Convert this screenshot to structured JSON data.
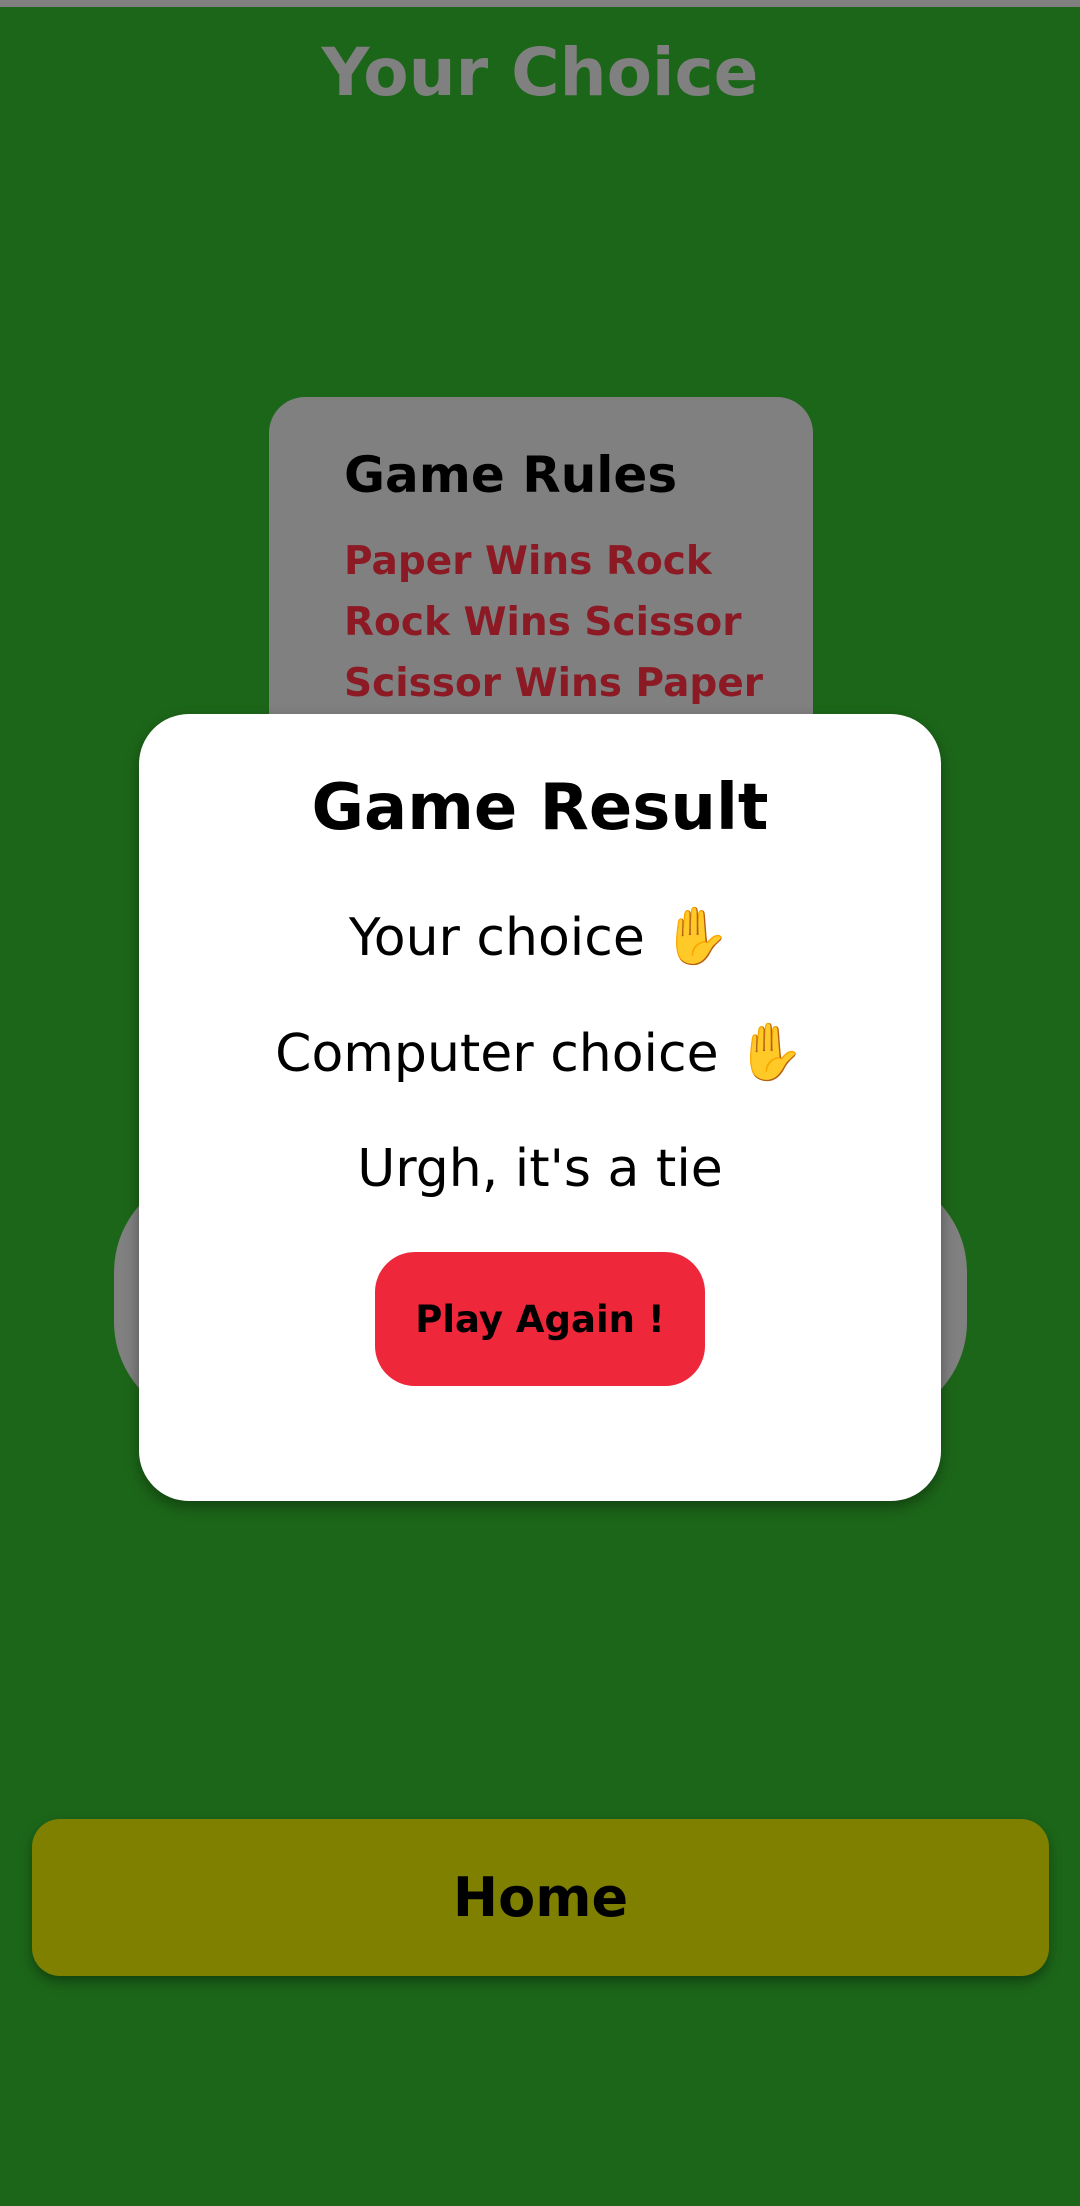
{
  "page": {
    "title": "Your Choice"
  },
  "rules": {
    "title": "Game Rules",
    "items": [
      "Paper Wins Rock",
      "Rock Wins Scissor",
      "Scissor Wins Paper"
    ]
  },
  "result": {
    "title": "Game Result",
    "your_choice_label": "Your choice",
    "your_choice_icon": "✋",
    "computer_choice_label": "Computer choice",
    "computer_choice_icon": "✋",
    "outcome": "Urgh, it's a tie",
    "play_again_label": "Play Again !"
  },
  "home": {
    "label": "Home"
  },
  "colors": {
    "background": "#1c6619",
    "card_gray": "#808080",
    "rule_text": "#8b1a24",
    "play_again": "#ee273a",
    "home_button": "#7f8000"
  }
}
